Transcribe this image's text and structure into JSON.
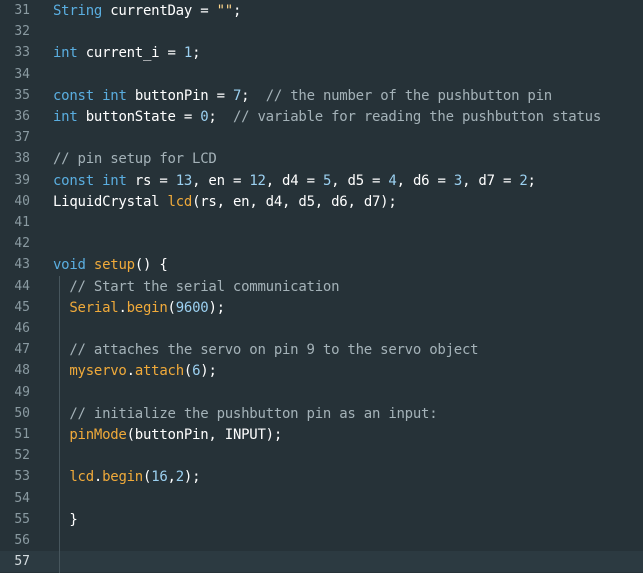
{
  "editor": {
    "first_line_number": 31,
    "current_line_number": 57,
    "lines": [
      {
        "num": "31",
        "tokens": [
          [
            "t-type",
            "String"
          ],
          [
            "t-plain",
            " currentDay = "
          ],
          [
            "t-string",
            "\"\""
          ],
          [
            "t-plain",
            ";"
          ]
        ]
      },
      {
        "num": "32",
        "tokens": []
      },
      {
        "num": "33",
        "tokens": [
          [
            "t-type",
            "int"
          ],
          [
            "t-plain",
            " current_i = "
          ],
          [
            "t-number",
            "1"
          ],
          [
            "t-plain",
            ";"
          ]
        ]
      },
      {
        "num": "34",
        "tokens": []
      },
      {
        "num": "35",
        "tokens": [
          [
            "t-keyword",
            "const"
          ],
          [
            "t-plain",
            " "
          ],
          [
            "t-type",
            "int"
          ],
          [
            "t-plain",
            " buttonPin = "
          ],
          [
            "t-number",
            "7"
          ],
          [
            "t-plain",
            ";  "
          ],
          [
            "t-comment",
            "// the number of the pushbutton pin"
          ]
        ]
      },
      {
        "num": "36",
        "tokens": [
          [
            "t-type",
            "int"
          ],
          [
            "t-plain",
            " buttonState = "
          ],
          [
            "t-number",
            "0"
          ],
          [
            "t-plain",
            ";  "
          ],
          [
            "t-comment",
            "// variable for reading the pushbutton status"
          ]
        ]
      },
      {
        "num": "37",
        "tokens": []
      },
      {
        "num": "38",
        "tokens": [
          [
            "t-comment",
            "// pin setup for LCD"
          ]
        ]
      },
      {
        "num": "39",
        "tokens": [
          [
            "t-keyword",
            "const"
          ],
          [
            "t-plain",
            " "
          ],
          [
            "t-type",
            "int"
          ],
          [
            "t-plain",
            " rs = "
          ],
          [
            "t-number",
            "13"
          ],
          [
            "t-plain",
            ", en = "
          ],
          [
            "t-number",
            "12"
          ],
          [
            "t-plain",
            ", d4 = "
          ],
          [
            "t-number",
            "5"
          ],
          [
            "t-plain",
            ", d5 = "
          ],
          [
            "t-number",
            "4"
          ],
          [
            "t-plain",
            ", d6 = "
          ],
          [
            "t-number",
            "3"
          ],
          [
            "t-plain",
            ", d7 = "
          ],
          [
            "t-number",
            "2"
          ],
          [
            "t-plain",
            ";"
          ]
        ]
      },
      {
        "num": "40",
        "tokens": [
          [
            "t-plain",
            "LiquidCrystal "
          ],
          [
            "t-func",
            "lcd"
          ],
          [
            "t-plain",
            "(rs, en, d4, d5, d6, d7);"
          ]
        ]
      },
      {
        "num": "41",
        "tokens": []
      },
      {
        "num": "42",
        "tokens": []
      },
      {
        "num": "43",
        "tokens": [
          [
            "t-type",
            "void"
          ],
          [
            "t-plain",
            " "
          ],
          [
            "t-func",
            "setup"
          ],
          [
            "t-plain",
            "() {"
          ]
        ]
      },
      {
        "num": "44",
        "tokens": [
          [
            "t-plain",
            "  "
          ],
          [
            "t-comment",
            "// Start the serial communication"
          ]
        ]
      },
      {
        "num": "45",
        "tokens": [
          [
            "t-plain",
            "  "
          ],
          [
            "t-func",
            "Serial"
          ],
          [
            "t-plain",
            "."
          ],
          [
            "t-func",
            "begin"
          ],
          [
            "t-plain",
            "("
          ],
          [
            "t-number",
            "9600"
          ],
          [
            "t-plain",
            ");"
          ]
        ]
      },
      {
        "num": "46",
        "tokens": []
      },
      {
        "num": "47",
        "tokens": [
          [
            "t-plain",
            "  "
          ],
          [
            "t-comment",
            "// attaches the servo on pin 9 to the servo object"
          ]
        ]
      },
      {
        "num": "48",
        "tokens": [
          [
            "t-plain",
            "  "
          ],
          [
            "t-func",
            "myservo"
          ],
          [
            "t-plain",
            "."
          ],
          [
            "t-func",
            "attach"
          ],
          [
            "t-plain",
            "("
          ],
          [
            "t-number",
            "6"
          ],
          [
            "t-plain",
            ");"
          ]
        ]
      },
      {
        "num": "49",
        "tokens": []
      },
      {
        "num": "50",
        "tokens": [
          [
            "t-plain",
            "  "
          ],
          [
            "t-comment",
            "// initialize the pushbutton pin as an input:"
          ]
        ]
      },
      {
        "num": "51",
        "tokens": [
          [
            "t-plain",
            "  "
          ],
          [
            "t-func",
            "pinMode"
          ],
          [
            "t-plain",
            "(buttonPin, INPUT);"
          ]
        ]
      },
      {
        "num": "52",
        "tokens": []
      },
      {
        "num": "53",
        "tokens": [
          [
            "t-plain",
            "  "
          ],
          [
            "t-func",
            "lcd"
          ],
          [
            "t-plain",
            "."
          ],
          [
            "t-func",
            "begin"
          ],
          [
            "t-plain",
            "("
          ],
          [
            "t-number",
            "16"
          ],
          [
            "t-plain",
            ","
          ],
          [
            "t-number",
            "2"
          ],
          [
            "t-plain",
            ");"
          ]
        ]
      },
      {
        "num": "54",
        "tokens": []
      },
      {
        "num": "55",
        "tokens": [
          [
            "t-plain",
            "  }"
          ]
        ]
      },
      {
        "num": "56",
        "tokens": []
      },
      {
        "num": "57",
        "tokens": []
      }
    ]
  },
  "colors": {
    "background": "#263238",
    "current_line": "#2c3a41",
    "line_number": "#8a9aa1",
    "keyword": "#5aaee0",
    "function": "#f0aa3a",
    "number": "#9bd0f0",
    "string": "#ffd78c",
    "comment": "#a4b2b8",
    "text": "#ffffff"
  }
}
